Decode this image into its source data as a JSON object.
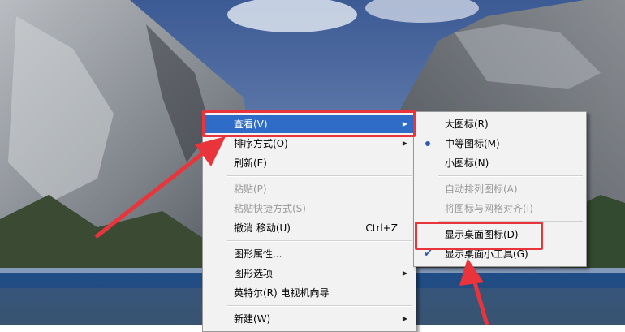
{
  "context_menu": {
    "items": [
      {
        "label": "查看(V)",
        "shortcut": "",
        "submenu": true,
        "disabled": false,
        "highlighted": true
      },
      {
        "label": "排序方式(O)",
        "shortcut": "",
        "submenu": true,
        "disabled": false,
        "highlighted": false
      },
      {
        "label": "刷新(E)",
        "shortcut": "",
        "submenu": false,
        "disabled": false,
        "highlighted": false
      },
      {
        "label": "粘贴(P)",
        "shortcut": "",
        "submenu": false,
        "disabled": true,
        "highlighted": false
      },
      {
        "label": "粘贴快捷方式(S)",
        "shortcut": "",
        "submenu": false,
        "disabled": true,
        "highlighted": false
      },
      {
        "label": "撤消 移动(U)",
        "shortcut": "Ctrl+Z",
        "submenu": false,
        "disabled": false,
        "highlighted": false
      },
      {
        "label": "图形属性...",
        "shortcut": "",
        "submenu": false,
        "disabled": false,
        "highlighted": false
      },
      {
        "label": "图形选项",
        "shortcut": "",
        "submenu": true,
        "disabled": false,
        "highlighted": false
      },
      {
        "label": "英特尔(R) 电视机向导",
        "shortcut": "",
        "submenu": false,
        "disabled": false,
        "highlighted": false
      },
      {
        "label": "新建(W)",
        "shortcut": "",
        "submenu": true,
        "disabled": false,
        "highlighted": false
      }
    ]
  },
  "view_submenu": {
    "items": [
      {
        "label": "大图标(R)",
        "disabled": false,
        "radio_selected": false,
        "checked": false
      },
      {
        "label": "中等图标(M)",
        "disabled": false,
        "radio_selected": true,
        "checked": false
      },
      {
        "label": "小图标(N)",
        "disabled": false,
        "radio_selected": false,
        "checked": false
      },
      {
        "label": "自动排列图标(A)",
        "disabled": true,
        "radio_selected": false,
        "checked": false
      },
      {
        "label": "将图标与网格对齐(I)",
        "disabled": true,
        "radio_selected": false,
        "checked": false
      },
      {
        "label": "显示桌面图标(D)",
        "disabled": false,
        "radio_selected": false,
        "checked": false
      },
      {
        "label": "显示桌面小工具(G)",
        "disabled": false,
        "radio_selected": false,
        "checked": true
      }
    ]
  },
  "colors": {
    "annotation": "#e8343a",
    "highlight": "#2e6cc8",
    "menu_bg": "#f2f2f2"
  }
}
